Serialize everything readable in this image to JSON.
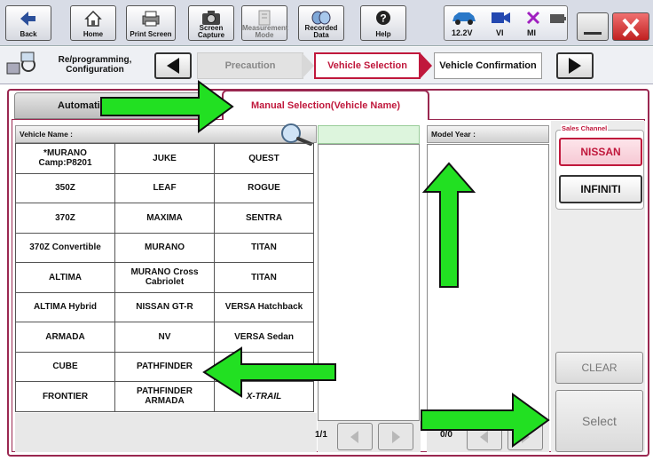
{
  "toolbar": {
    "back": "Back",
    "home": "Home",
    "print_screen": "Print Screen",
    "screen_capture": "Screen Capture",
    "measurement_mode": "Measurement Mode",
    "recorded_data": "Recorded Data",
    "help": "Help",
    "voltage": "12.2V",
    "vi": "VI",
    "mi": "MI"
  },
  "nav": {
    "section": "Re/programming, Configuration",
    "steps": [
      "Precaution",
      "Vehicle Selection",
      "Vehicle Confirmation"
    ]
  },
  "tabs": {
    "automatic": "Automatic",
    "manual": "Manual Selection(Vehicle Name)"
  },
  "vehicle_header": "Vehicle Name :",
  "model_year_header": "Model Year :",
  "vehicles": [
    [
      "*MURANO Camp:P8201",
      "JUKE",
      "QUEST"
    ],
    [
      "350Z",
      "LEAF",
      "ROGUE"
    ],
    [
      "370Z",
      "MAXIMA",
      "SENTRA"
    ],
    [
      "370Z Convertible",
      "MURANO",
      "TITAN"
    ],
    [
      "ALTIMA",
      "MURANO Cross Cabriolet",
      "TITAN"
    ],
    [
      "ALTIMA Hybrid",
      "NISSAN GT-R",
      "VERSA Hatchback"
    ],
    [
      "ARMADA",
      "NV",
      "VERSA Sedan"
    ],
    [
      "CUBE",
      "PATHFINDER",
      ""
    ],
    [
      "FRONTIER",
      "PATHFINDER ARMADA",
      "X-TRAIL"
    ]
  ],
  "page_indicator": "1/1",
  "model_page_indicator": "0/0",
  "sales_channel": {
    "title": "Sales Channel",
    "nissan": "NISSAN",
    "infiniti": "INFINITI"
  },
  "buttons": {
    "clear": "CLEAR",
    "select": "Select"
  },
  "colors": {
    "accent": "#c0183c",
    "frame": "#9a2750",
    "arrow": "#22e022"
  }
}
